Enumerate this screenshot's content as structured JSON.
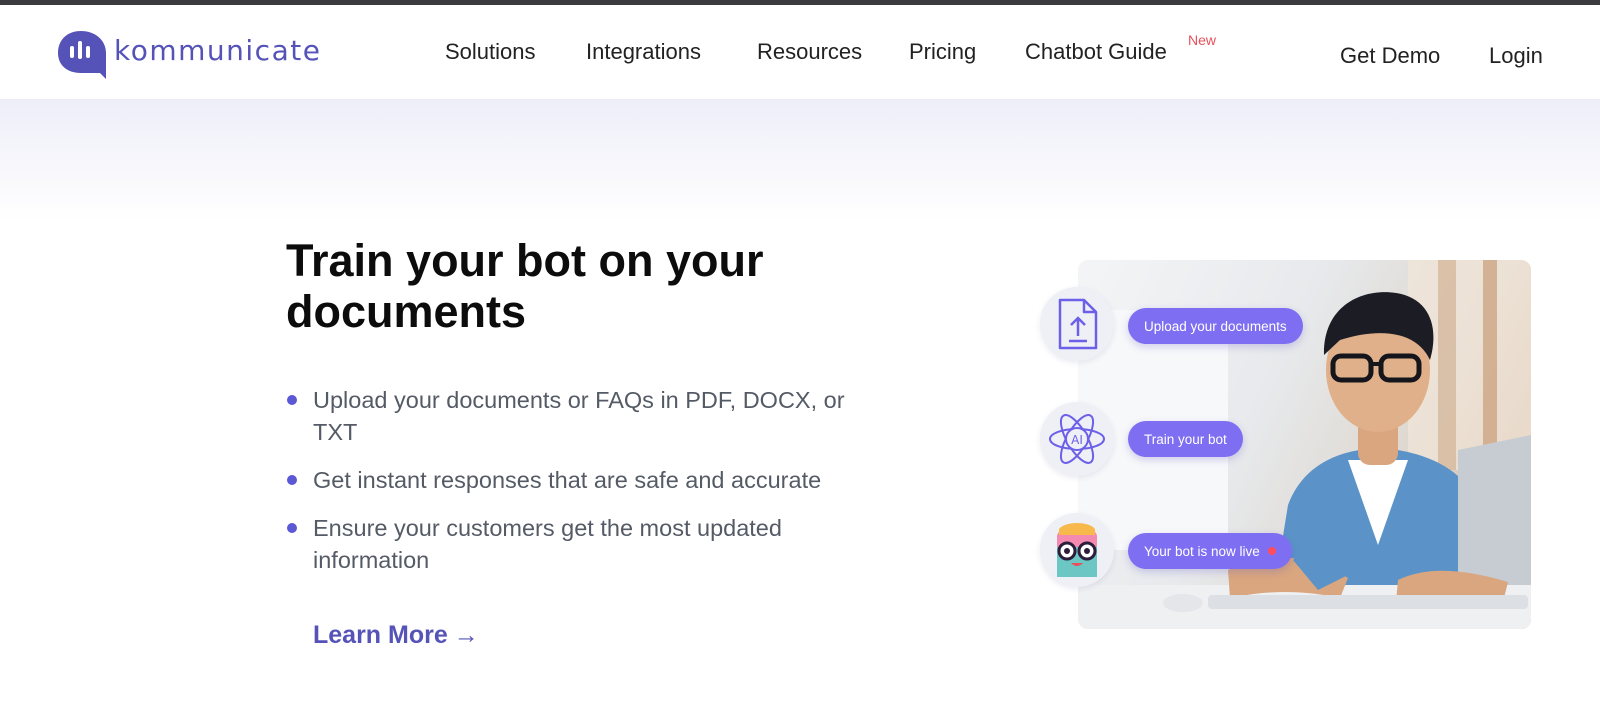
{
  "brand": {
    "name": "kommunicate",
    "color": "#5553b7",
    "icon": "chat-bubble-logo-icon"
  },
  "nav": {
    "items": [
      "Solutions",
      "Integrations",
      "Resources",
      "Pricing",
      "Chatbot Guide"
    ],
    "new_badge": "New",
    "get_demo": "Get Demo",
    "login": "Login"
  },
  "section": {
    "title": "Train your bot on your documents",
    "bullets": [
      "Upload your documents or FAQs in PDF, DOCX, or TXT",
      "Get instant responses that are safe and accurate",
      "Ensure your customers get the most updated information"
    ],
    "learn_more": "Learn More",
    "learn_more_arrow": "→"
  },
  "illustration": {
    "steps": [
      {
        "label": "Upload your documents",
        "icon": "document-upload-icon"
      },
      {
        "label": "Train your bot",
        "icon": "ai-atom-icon"
      },
      {
        "label": "Your bot is now live",
        "icon": "bot-avatar-icon"
      }
    ],
    "accent": "#7e6ff2",
    "live_color": "#ff4d5e"
  }
}
